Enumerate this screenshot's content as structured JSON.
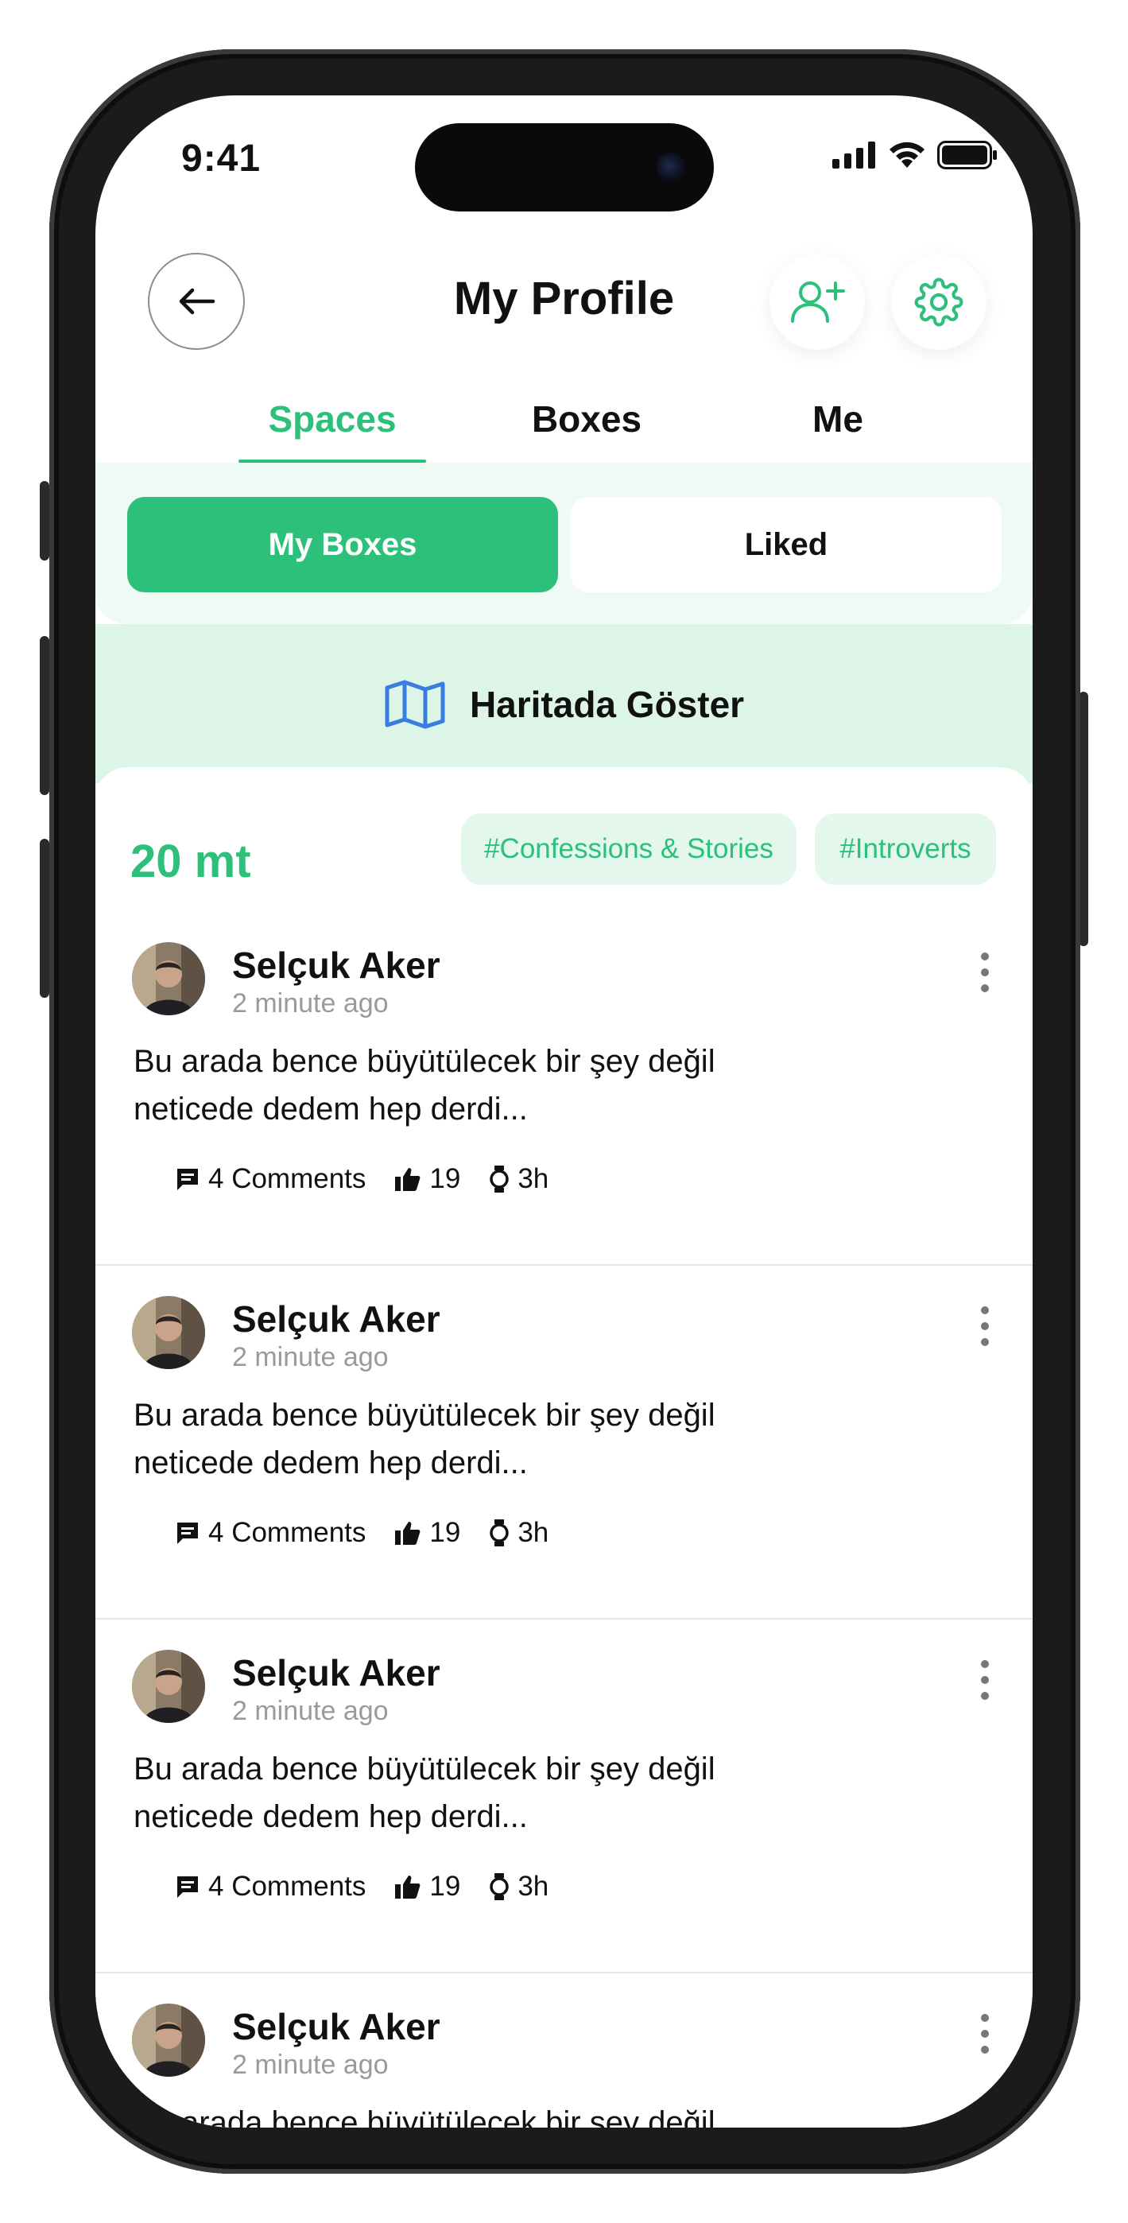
{
  "status_bar": {
    "time": "9:41"
  },
  "header": {
    "title": "My Profile"
  },
  "tabs": [
    {
      "label": "Spaces",
      "active": true
    },
    {
      "label": "Boxes",
      "active": false
    },
    {
      "label": "Me",
      "active": false
    }
  ],
  "segments": {
    "active": "My Boxes",
    "inactive": "Liked"
  },
  "map_button": {
    "label": "Haritada Göster",
    "icon": "map-icon"
  },
  "filters": {
    "distance": "20 mt",
    "tags": [
      "#Confessions & Stories",
      "#Introverts"
    ]
  },
  "posts": [
    {
      "author": "Selçuk Aker",
      "time": "2 minute ago",
      "text_line1": "Bu arada bence büyütülecek bir şey değil",
      "text_line2": "neticede dedem hep derdi...",
      "comments": "4 Comments",
      "likes": "19",
      "duration": "3h"
    },
    {
      "author": "Selçuk Aker",
      "time": "2 minute ago",
      "text_line1": "Bu arada bence büyütülecek bir şey değil",
      "text_line2": "neticede dedem hep derdi...",
      "comments": "4 Comments",
      "likes": "19",
      "duration": "3h"
    },
    {
      "author": "Selçuk Aker",
      "time": "2 minute ago",
      "text_line1": "Bu arada bence büyütülecek bir şey değil",
      "text_line2": "neticede dedem hep derdi...",
      "comments": "4 Comments",
      "likes": "19",
      "duration": "3h"
    },
    {
      "author": "Selçuk Aker",
      "time": "2 minute ago",
      "text_line1": "Bu arada bence büyütülecek bir şey değil",
      "text_line2": "",
      "comments": "",
      "likes": "",
      "duration": ""
    }
  ],
  "colors": {
    "accent": "#2dc07a",
    "accent_light": "#e4f7ec",
    "map_icon": "#3a7de0"
  }
}
